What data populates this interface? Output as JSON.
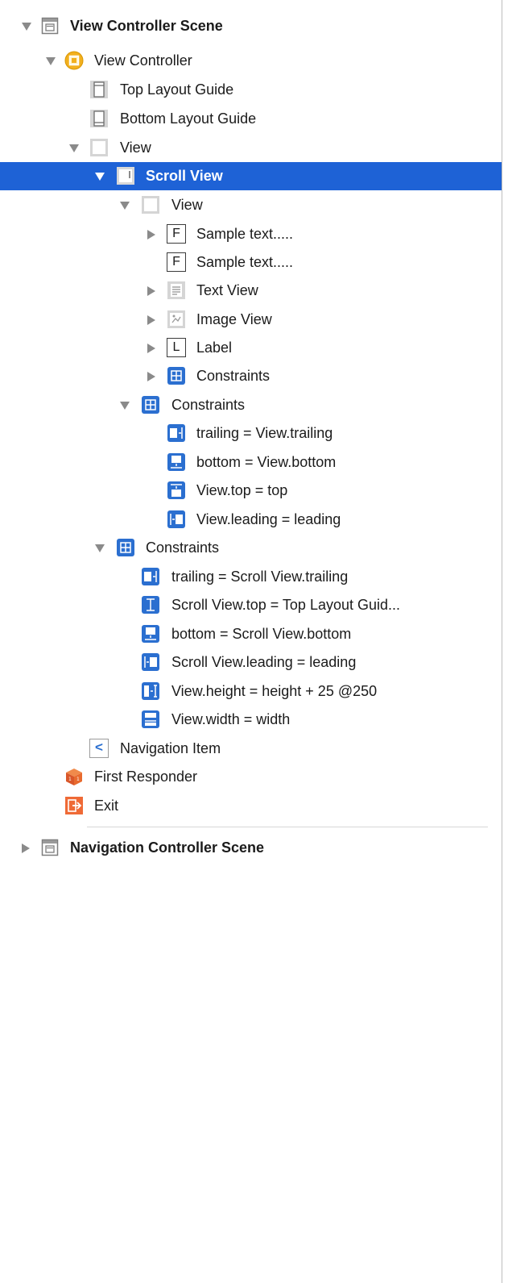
{
  "outline": {
    "scenes": [
      {
        "label": "View Controller Scene",
        "expanded": true
      },
      {
        "label": "Navigation Controller Scene",
        "expanded": false
      }
    ],
    "rows": [
      {
        "label": "View Controller Scene",
        "icon": "scene-icon",
        "disclosure": "expanded"
      },
      {
        "label": "View Controller",
        "icon": "view-controller-icon",
        "disclosure": "expanded"
      },
      {
        "label": "Top Layout Guide",
        "icon": "top-layout-guide-icon",
        "disclosure": "none"
      },
      {
        "label": "Bottom Layout Guide",
        "icon": "bottom-layout-guide-icon",
        "disclosure": "none"
      },
      {
        "label": "View",
        "icon": "view-icon",
        "disclosure": "expanded"
      },
      {
        "label": "Scroll View",
        "icon": "scroll-view-icon",
        "disclosure": "expanded",
        "selected": true
      },
      {
        "label": "View",
        "icon": "view-icon",
        "disclosure": "expanded"
      },
      {
        "label": "Sample text.....",
        "icon": "text-field-icon",
        "icon_glyph": "F",
        "disclosure": "collapsed"
      },
      {
        "label": "Sample text.....",
        "icon": "text-field-icon",
        "icon_glyph": "F",
        "disclosure": "none"
      },
      {
        "label": "Text View",
        "icon": "text-view-icon",
        "disclosure": "collapsed"
      },
      {
        "label": "Image View",
        "icon": "image-view-icon",
        "disclosure": "collapsed"
      },
      {
        "label": "Label",
        "icon": "label-icon",
        "icon_glyph": "L",
        "disclosure": "collapsed"
      },
      {
        "label": "Constraints",
        "icon": "constraints-icon",
        "disclosure": "collapsed"
      },
      {
        "label": "Constraints",
        "icon": "constraints-icon",
        "disclosure": "expanded"
      },
      {
        "label": "trailing = View.trailing",
        "icon": "constraint-trailing-icon",
        "disclosure": "none"
      },
      {
        "label": "bottom = View.bottom",
        "icon": "constraint-bottom-icon",
        "disclosure": "none"
      },
      {
        "label": "View.top = top",
        "icon": "constraint-top-icon",
        "disclosure": "none"
      },
      {
        "label": "View.leading = leading",
        "icon": "constraint-leading-icon",
        "disclosure": "none"
      },
      {
        "label": "Constraints",
        "icon": "constraints-icon",
        "disclosure": "expanded"
      },
      {
        "label": "trailing = Scroll View.trailing",
        "icon": "constraint-trailing-icon",
        "disclosure": "none"
      },
      {
        "label": "Scroll View.top = Top Layout Guid...",
        "icon": "constraint-vertical-spacing-icon",
        "disclosure": "none"
      },
      {
        "label": "bottom = Scroll View.bottom",
        "icon": "constraint-bottom-icon",
        "disclosure": "none"
      },
      {
        "label": "Scroll View.leading = leading",
        "icon": "constraint-leading-icon",
        "disclosure": "none"
      },
      {
        "label": "View.height = height + 25 @250",
        "icon": "constraint-height-icon",
        "disclosure": "none"
      },
      {
        "label": "View.width = width",
        "icon": "constraint-width-icon",
        "disclosure": "none"
      },
      {
        "label": "Navigation Item",
        "icon": "navigation-item-icon",
        "icon_glyph": "<",
        "disclosure": "none"
      },
      {
        "label": "First Responder",
        "icon": "first-responder-icon",
        "disclosure": "none"
      },
      {
        "label": "Exit",
        "icon": "exit-icon",
        "disclosure": "none"
      },
      {
        "label": "Navigation Controller Scene",
        "icon": "scene-icon",
        "disclosure": "collapsed"
      }
    ],
    "colors": {
      "selection": "#1e62d6",
      "constraint_blue": "#2b6fd0",
      "view_controller_yellow": "#f2b01e",
      "first_responder_orange": "#e86a2e",
      "exit_orange": "#ef6a36"
    }
  }
}
